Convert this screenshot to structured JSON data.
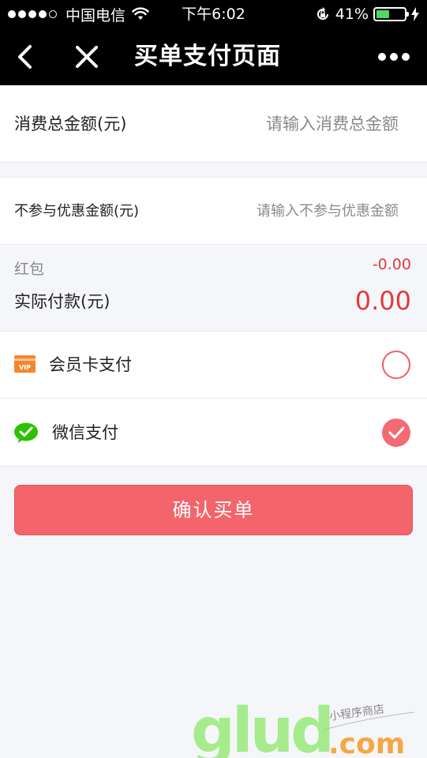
{
  "status_bar": {
    "carrier": "中国电信",
    "time": "下午6:02",
    "battery": "41%"
  },
  "nav": {
    "title": "买单支付页面"
  },
  "form": {
    "total_label": "消费总金额(元)",
    "total_placeholder": "请输入消费总金额",
    "exclude_label": "不参与优惠金额(元)",
    "exclude_placeholder": "请输入不参与优惠金额"
  },
  "summary": {
    "hongbao_label": "红包",
    "hongbao_value": "-0.00",
    "actual_label": "实际付款(元)",
    "actual_value": "0.00"
  },
  "payment_options": [
    {
      "label": "会员卡支付",
      "icon": "vip-card-icon",
      "selected": false
    },
    {
      "label": "微信支付",
      "icon": "wechat-icon",
      "selected": true
    }
  ],
  "confirm_label": "确认买单",
  "watermark": {
    "logo_text": "glud.com",
    "tagline": "小程序商店"
  },
  "colors": {
    "accent": "#f4646b",
    "price_red": "#e03c3c",
    "vip_orange": "#f5862d",
    "wechat_green": "#2dc100",
    "nav_bg": "#000000",
    "page_bg": "#f5f6fa"
  }
}
